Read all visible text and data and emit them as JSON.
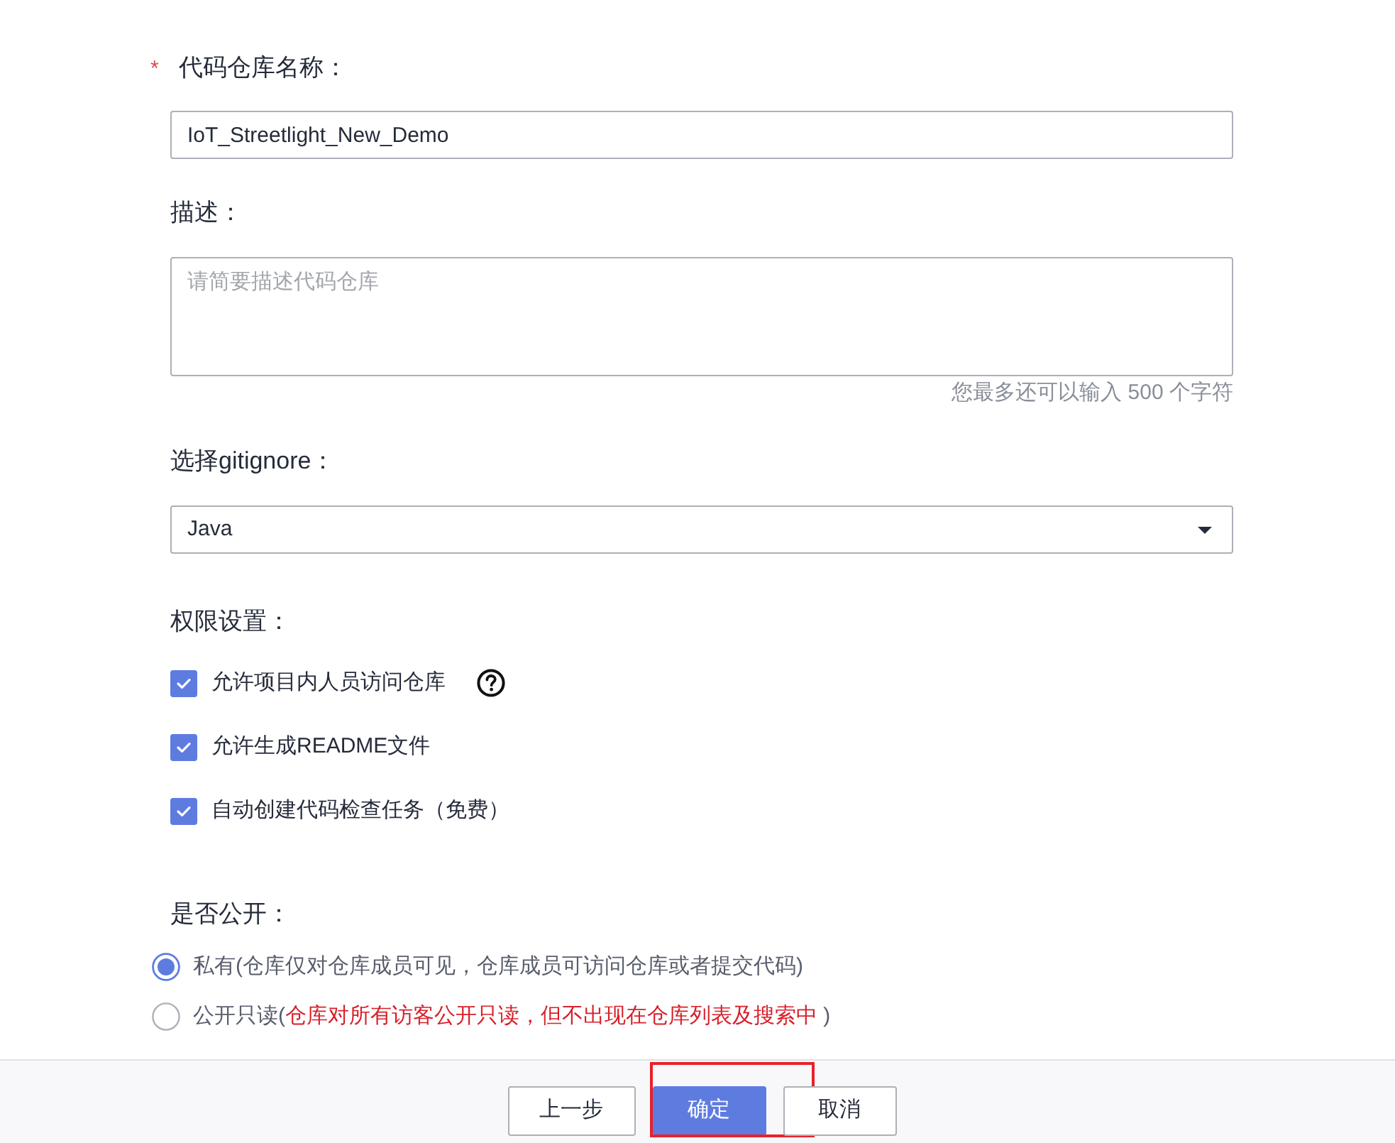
{
  "fields": [
    {
      "kind": "text",
      "label": "代码仓库名称：",
      "required_mark": "*",
      "value": "IoT_Streetlight_New_Demo"
    },
    {
      "kind": "textarea",
      "label": "描述：",
      "placeholder": "请简要描述代码仓库",
      "counter": "您最多还可以输入 500 个字符"
    },
    {
      "kind": "select",
      "label": "选择gitignore：",
      "value": "Java"
    }
  ],
  "permissions": {
    "label": "权限设置：",
    "options": [
      {
        "label": "允许项目内人员访问仓库",
        "checked": true,
        "help": true
      },
      {
        "label": "允许生成README文件",
        "checked": true
      },
      {
        "label": "自动创建代码检查任务（免费）",
        "checked": true
      }
    ]
  },
  "visibility": {
    "label": "是否公开：",
    "options": [
      {
        "text": "私有(仓库仅对仓库成员可见，仓库成员可访问仓库或者提交代码)",
        "selected": true
      },
      {
        "text": "公开只读(",
        "warning": "仓库对所有访客公开只读，但不出现在仓库列表及搜索中",
        "text_end": " )",
        "selected": false
      }
    ]
  },
  "buttons": [
    {
      "kind": "default",
      "label": "上一步",
      "highlighted": false
    },
    {
      "kind": "primary",
      "label": "确定",
      "highlighted": true
    },
    {
      "kind": "default",
      "label": "取消",
      "highlighted": false
    }
  ]
}
